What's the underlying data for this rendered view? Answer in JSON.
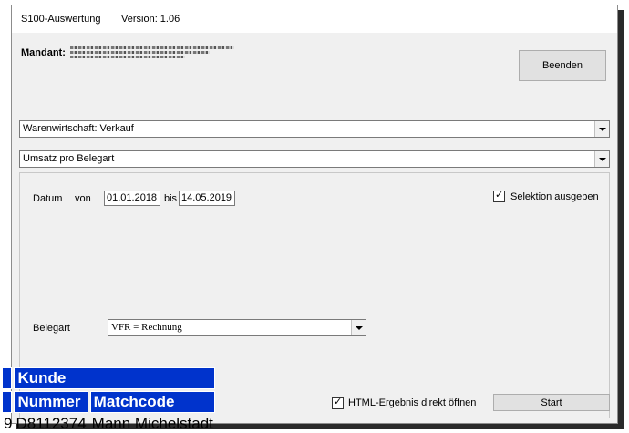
{
  "window": {
    "app_name": "S100-Auswertung",
    "version": "Version: 1.06"
  },
  "mandant": {
    "label": "Mandant:",
    "value_obscured": true
  },
  "buttons": {
    "beenden": "Beenden",
    "start": "Start"
  },
  "module_select": {
    "value": "Warenwirtschaft: Verkauf"
  },
  "report_select": {
    "value": "Umsatz pro Belegart"
  },
  "criteria": {
    "datum_label": "Datum",
    "von_label": "von",
    "von_value": "01.01.2018",
    "bis_label": "bis",
    "bis_value": "14.05.2019",
    "selektion_label": "Selektion ausgeben",
    "selektion_checked": true,
    "belegart_label": "Belegart",
    "belegart_value": "VFR = Rechnung",
    "html_label": "HTML-Ergebnis direkt öffnen",
    "html_checked": true
  },
  "overlay_table": {
    "group_header": "Kunde",
    "col_nummer": "Nummer",
    "col_matchcode": "Matchcode",
    "row_prefix": "9",
    "row_nummer": "D8112374",
    "row_matchcode": "Mann Michelstadt"
  },
  "colors": {
    "table_header": "#0033cc",
    "window_bg": "#f0f0f0"
  }
}
